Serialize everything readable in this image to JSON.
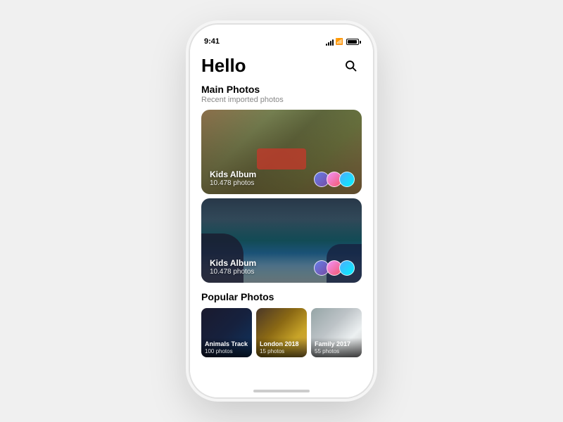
{
  "statusBar": {
    "time": "9:41"
  },
  "header": {
    "title": "Hello",
    "searchLabel": "Search"
  },
  "mainSection": {
    "title": "Main Photos",
    "subtitle": "Recent imported photos"
  },
  "albums": [
    {
      "id": "album-1",
      "name": "Kids Album",
      "count": "10.478 photos",
      "theme": "warm"
    },
    {
      "id": "album-2",
      "name": "Kids Album",
      "count": "10.478 photos",
      "theme": "coastal"
    }
  ],
  "popularSection": {
    "title": "Popular Photos",
    "items": [
      {
        "id": "popular-1",
        "name": "Animals Track",
        "count": "100 photos"
      },
      {
        "id": "popular-2",
        "name": "London 2018",
        "count": "15 photos"
      },
      {
        "id": "popular-3",
        "name": "Family 2017",
        "count": "55 photos"
      }
    ]
  }
}
